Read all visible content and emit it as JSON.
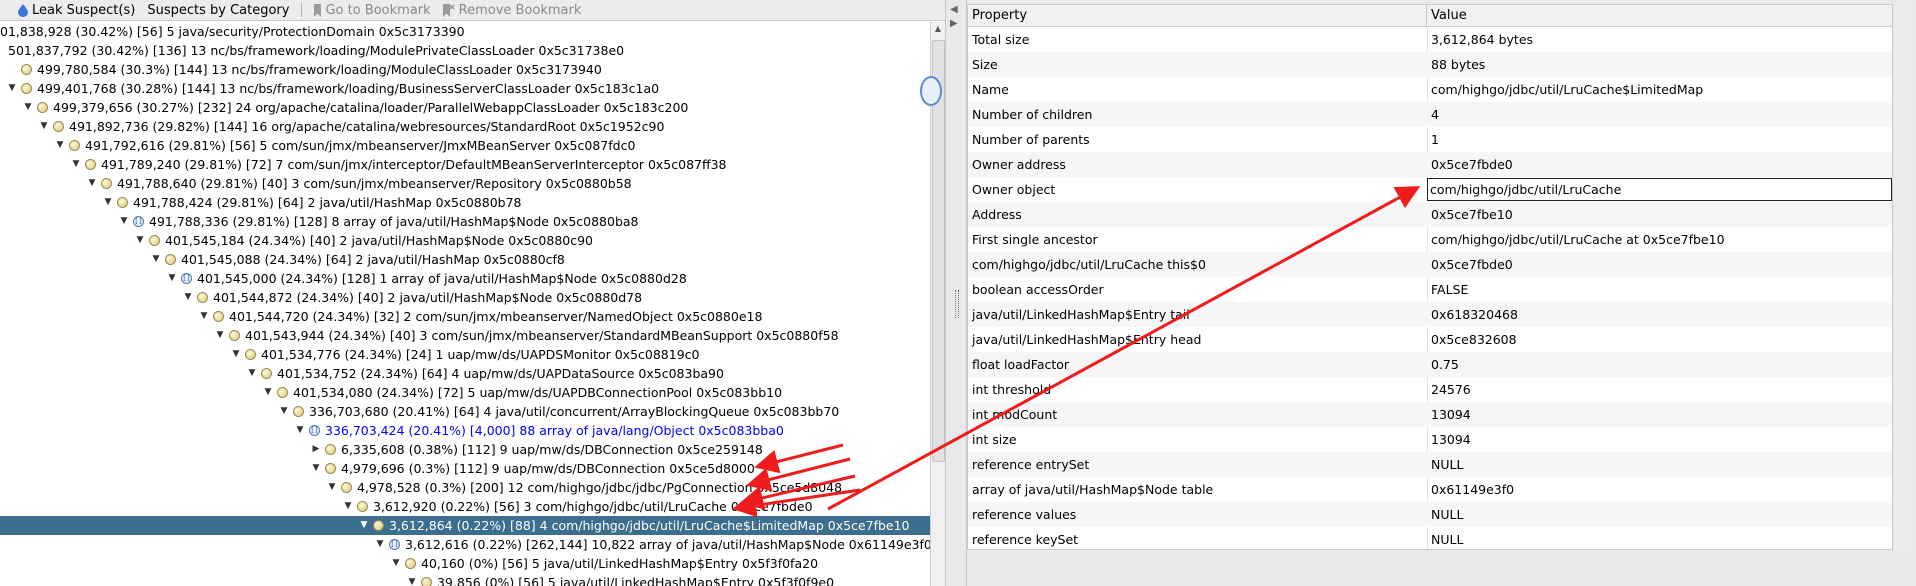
{
  "toolbar": {
    "leak_suspects": "Leak Suspect(s)",
    "suspects_by_category": "Suspects by Category",
    "go_to_bookmark": "Go to Bookmark",
    "remove_bookmark": "Remove Bookmark"
  },
  "tree_rows": [
    {
      "text": "01,838,928 (30.42%) [56] 5 java/security/ProtectionDomain 0x5c3173390",
      "level": 0,
      "toggle": "",
      "icon": "none",
      "style": "normal"
    },
    {
      "text": "501,837,792 (30.42%) [136] 13 nc/bs/framework/loading/ModulePrivateClassLoader 0x5c31738e0",
      "level": 0,
      "toggle": "",
      "icon": "none",
      "style": "normal"
    },
    {
      "text": "499,780,584 (30.3%) [144] 13 nc/bs/framework/loading/ModuleClassLoader 0x5c3173940",
      "level": 0,
      "toggle": "",
      "icon": "obj",
      "style": "normal"
    },
    {
      "text": "499,401,768 (30.28%) [144] 13 nc/bs/framework/loading/BusinessServerClassLoader 0x5c183c1a0",
      "level": 0,
      "toggle": "▼",
      "icon": "obj",
      "style": "normal"
    },
    {
      "text": "499,379,656 (30.27%) [232] 24 org/apache/catalina/loader/ParallelWebappClassLoader 0x5c183c200",
      "level": 1,
      "toggle": "▼",
      "icon": "obj",
      "style": "normal"
    },
    {
      "text": "491,892,736 (29.82%) [144] 16 org/apache/catalina/webresources/StandardRoot 0x5c1952c90",
      "level": 2,
      "toggle": "▼",
      "icon": "obj",
      "style": "normal"
    },
    {
      "text": "491,792,616 (29.81%) [56] 5 com/sun/jmx/mbeanserver/JmxMBeanServer 0x5c087fdc0",
      "level": 3,
      "toggle": "▼",
      "icon": "obj",
      "style": "normal"
    },
    {
      "text": "491,789,240 (29.81%) [72] 7 com/sun/jmx/interceptor/DefaultMBeanServerInterceptor 0x5c087ff38",
      "level": 4,
      "toggle": "▼",
      "icon": "obj",
      "style": "normal"
    },
    {
      "text": "491,788,640 (29.81%) [40] 3 com/sun/jmx/mbeanserver/Repository 0x5c0880b58",
      "level": 5,
      "toggle": "▼",
      "icon": "obj",
      "style": "normal"
    },
    {
      "text": "491,788,424 (29.81%) [64] 2 java/util/HashMap 0x5c0880b78",
      "level": 6,
      "toggle": "▼",
      "icon": "obj",
      "style": "normal"
    },
    {
      "text": "491,788,336 (29.81%) [128] 8 array of java/util/HashMap$Node 0x5c0880ba8",
      "level": 7,
      "toggle": "▼",
      "icon": "arr",
      "style": "normal"
    },
    {
      "text": "401,545,184 (24.34%) [40] 2 java/util/HashMap$Node 0x5c0880c90",
      "level": 8,
      "toggle": "▼",
      "icon": "obj",
      "style": "normal"
    },
    {
      "text": "401,545,088 (24.34%) [64] 2 java/util/HashMap 0x5c0880cf8",
      "level": 9,
      "toggle": "▼",
      "icon": "obj",
      "style": "normal"
    },
    {
      "text": "401,545,000 (24.34%) [128] 1 array of java/util/HashMap$Node 0x5c0880d28",
      "level": 10,
      "toggle": "▼",
      "icon": "arr",
      "style": "normal"
    },
    {
      "text": "401,544,872 (24.34%) [40] 2 java/util/HashMap$Node 0x5c0880d78",
      "level": 11,
      "toggle": "▼",
      "icon": "obj",
      "style": "normal"
    },
    {
      "text": "401,544,720 (24.34%) [32] 2 com/sun/jmx/mbeanserver/NamedObject 0x5c0880e18",
      "level": 12,
      "toggle": "▼",
      "icon": "obj",
      "style": "normal"
    },
    {
      "text": "401,543,944 (24.34%) [40] 3 com/sun/jmx/mbeanserver/StandardMBeanSupport 0x5c0880f58",
      "level": 13,
      "toggle": "▼",
      "icon": "obj",
      "style": "normal"
    },
    {
      "text": "401,534,776 (24.34%) [24] 1 uap/mw/ds/UAPDSMonitor 0x5c08819c0",
      "level": 14,
      "toggle": "▼",
      "icon": "obj",
      "style": "normal"
    },
    {
      "text": "401,534,752 (24.34%) [64] 4 uap/mw/ds/UAPDataSource 0x5c083ba90",
      "level": 15,
      "toggle": "▼",
      "icon": "obj",
      "style": "normal"
    },
    {
      "text": "401,534,080 (24.34%) [72] 5 uap/mw/ds/UAPDBConnectionPool 0x5c083bb10",
      "level": 16,
      "toggle": "▼",
      "icon": "obj",
      "style": "normal"
    },
    {
      "text": "336,703,680 (20.41%) [64] 4 java/util/concurrent/ArrayBlockingQueue 0x5c083bb70",
      "level": 17,
      "toggle": "▼",
      "icon": "obj",
      "style": "normal"
    },
    {
      "text": "336,703,424 (20.41%) [4,000] 88 array of java/lang/Object 0x5c083bba0",
      "level": 18,
      "toggle": "▼",
      "icon": "arr",
      "style": "blue"
    },
    {
      "text": "6,335,608 (0.38%) [112] 9 uap/mw/ds/DBConnection 0x5ce259148",
      "level": 19,
      "toggle": "▶",
      "icon": "obj",
      "style": "normal"
    },
    {
      "text": "4,979,696 (0.3%) [112] 9 uap/mw/ds/DBConnection 0x5ce5d8000",
      "level": 19,
      "toggle": "▼",
      "icon": "obj",
      "style": "normal"
    },
    {
      "text": "4,978,528 (0.3%) [200] 12 com/highgo/jdbc/jdbc/PgConnection 0x5ce5d8048",
      "level": 20,
      "toggle": "▼",
      "icon": "obj",
      "style": "normal"
    },
    {
      "text": "3,612,920 (0.22%) [56] 3 com/highgo/jdbc/util/LruCache 0x5ce7fbde0",
      "level": 21,
      "toggle": "▼",
      "icon": "obj",
      "style": "normal"
    },
    {
      "text": "3,612,864 (0.22%) [88] 4 com/highgo/jdbc/util/LruCache$LimitedMap 0x5ce7fbe10",
      "level": 22,
      "toggle": "▼",
      "icon": "obj",
      "style": "selected"
    },
    {
      "text": "3,612,616 (0.22%) [262,144] 10,822 array of java/util/HashMap$Node 0x61149e3f0",
      "level": 23,
      "toggle": "▼",
      "icon": "arr",
      "style": "normal"
    },
    {
      "text": "40,160 (0%) [56] 5 java/util/LinkedHashMap$Entry 0x5f3f0fa20",
      "level": 24,
      "toggle": "▼",
      "icon": "obj",
      "style": "normal"
    },
    {
      "text": "39,856 (0%) [56] 5 java/util/LinkedHashMap$Entry 0x5f3f0f9e0",
      "level": 25,
      "toggle": "▼",
      "icon": "obj",
      "style": "normal"
    }
  ],
  "props": {
    "header_property": "Property",
    "header_value": "Value",
    "rows": [
      {
        "name": "Total size",
        "value": "3,612,864 bytes"
      },
      {
        "name": "Size",
        "value": "88 bytes"
      },
      {
        "name": "Name",
        "value": "com/highgo/jdbc/util/LruCache$LimitedMap"
      },
      {
        "name": "Number of children",
        "value": "4"
      },
      {
        "name": "Number of parents",
        "value": "1"
      },
      {
        "name": "Owner address",
        "value": "0x5ce7fbde0"
      },
      {
        "name": "Owner object",
        "value": "com/highgo/jdbc/util/LruCache"
      },
      {
        "name": "Address",
        "value": "0x5ce7fbe10"
      },
      {
        "name": "First single ancestor",
        "value": "com/highgo/jdbc/util/LruCache at 0x5ce7fbe10"
      },
      {
        "name": "com/highgo/jdbc/util/LruCache this$0",
        "value": "0x5ce7fbde0"
      },
      {
        "name": "boolean accessOrder",
        "value": "FALSE"
      },
      {
        "name": "java/util/LinkedHashMap$Entry tail",
        "value": "0x618320468"
      },
      {
        "name": "java/util/LinkedHashMap$Entry head",
        "value": "0x5ce832608"
      },
      {
        "name": "float loadFactor",
        "value": "0.75"
      },
      {
        "name": "int threshold",
        "value": "24576"
      },
      {
        "name": "int modCount",
        "value": "13094"
      },
      {
        "name": "int size",
        "value": "13094"
      },
      {
        "name": "reference entrySet",
        "value": "NULL"
      },
      {
        "name": "array of java/util/HashMap$Node table",
        "value": "0x61149e3f0"
      },
      {
        "name": "reference values",
        "value": "NULL"
      },
      {
        "name": "reference keySet",
        "value": "NULL"
      }
    ]
  },
  "colors": {
    "selection": "#3b6e8f",
    "annotation": "#ee1c1c",
    "highlight_text": "#0000ff"
  }
}
